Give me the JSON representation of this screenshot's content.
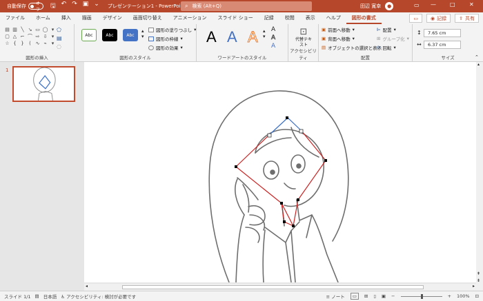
{
  "titlebar": {
    "autosave_label": "自動保存",
    "autosave_state": "オフ",
    "doc_title": "プレゼンテーション1 - PowerPoint",
    "search_placeholder": "検索 (Alt+Q)",
    "user_name": "田辺 寛幸",
    "window_controls": [
      "—",
      "□",
      "✕"
    ]
  },
  "tabs": [
    "ファイル",
    "ホーム",
    "挿入",
    "描画",
    "デザイン",
    "画面切り替え",
    "アニメーション",
    "スライド ショー",
    "記録",
    "校閲",
    "表示",
    "ヘルプ",
    "図形の書式"
  ],
  "active_tab": "図形の書式",
  "tab_buttons": {
    "record": "記録",
    "share": "共有"
  },
  "ribbon": {
    "groups": {
      "insert_shapes": "図形の挿入",
      "shape_styles": "図形のスタイル",
      "wordart_styles": "ワードアートのスタイル",
      "accessibility": "アクセシビリティ",
      "arrange": "配置",
      "size": "サイズ"
    },
    "style_samples": [
      "Abc",
      "Abc",
      "Abc"
    ],
    "shape_options": [
      "図形の塗りつぶし",
      "図形の枠線",
      "図形の効果"
    ],
    "wordart_samples": [
      "A",
      "A",
      "A"
    ],
    "alt_text": "代替テキスト",
    "arrange_items": [
      "前面へ移動",
      "背面へ移動",
      "オブジェクトの選択と表示"
    ],
    "arrange_right": [
      "配置",
      "グループ化",
      "回転"
    ],
    "height_value": "7.65 cm",
    "width_value": "6.37 cm"
  },
  "slides": {
    "current_number": "1"
  },
  "statusbar": {
    "slide_info": "スライド 1/1",
    "language": "日本語",
    "accessibility": "アクセシビリティ: 検討が必要です",
    "notes": "ノート",
    "zoom": "100%"
  },
  "colors": {
    "accent": "#b7472a",
    "ribbon_bg": "#f3f3f3",
    "selection_line": "#cc2222",
    "selection_line_top": "#3a6fc7"
  }
}
